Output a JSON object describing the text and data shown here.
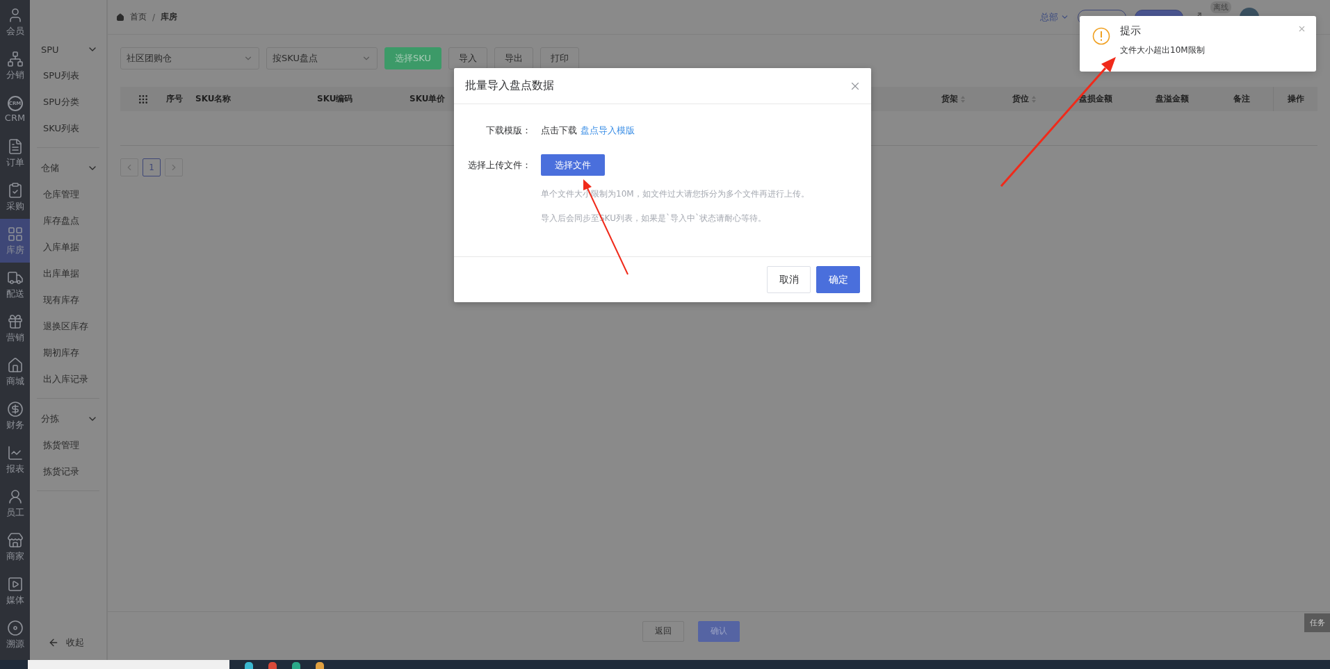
{
  "nav": [
    {
      "label": "会员",
      "selected": false
    },
    {
      "label": "分销",
      "selected": false
    },
    {
      "label": "CRM",
      "selected": false,
      "icon_text": "CRM"
    },
    {
      "label": "订单",
      "selected": false
    },
    {
      "label": "采购",
      "selected": false
    },
    {
      "label": "库房",
      "selected": true
    },
    {
      "label": "配送",
      "selected": false
    },
    {
      "label": "营销",
      "selected": false
    },
    {
      "label": "商城",
      "selected": false
    },
    {
      "label": "财务",
      "selected": false
    },
    {
      "label": "报表",
      "selected": false
    },
    {
      "label": "员工",
      "selected": false
    },
    {
      "label": "商家",
      "selected": false
    },
    {
      "label": "媒体",
      "selected": false
    },
    {
      "label": "溯源",
      "selected": false
    }
  ],
  "submenu": {
    "groups": [
      {
        "label": "SPU",
        "expanded": true,
        "items": [
          "SPU列表",
          "SPU分类",
          "SKU列表"
        ]
      },
      {
        "label": "仓储",
        "expanded": true,
        "items": [
          "仓库管理",
          "库存盘点",
          "入库单据",
          "出库单据",
          "现有库存",
          "退换区库存",
          "期初库存",
          "出入库记录"
        ]
      },
      {
        "label": "分拣",
        "expanded": true,
        "items": [
          "拣货管理",
          "拣货记录"
        ]
      }
    ],
    "collapse": "收起"
  },
  "breadcrumb": [
    "首页",
    "库房"
  ],
  "breadcrumb_separator": "/",
  "header": {
    "branch": "总部",
    "status_badge": "离线"
  },
  "toolbar": {
    "warehouse": "社区团购仓",
    "mode": "按SKU盘点",
    "buttons": [
      {
        "label": "选择SKU",
        "kind": "primary"
      },
      {
        "label": "导入",
        "kind": "plain"
      },
      {
        "label": "导出",
        "kind": "plain"
      },
      {
        "label": "打印",
        "kind": "plain"
      }
    ]
  },
  "table": {
    "columns_left": [
      {
        "label": "序号",
        "sortable": false
      },
      {
        "label": "SKU名称",
        "sortable": false
      },
      {
        "label": "SKU编码",
        "sortable": false
      },
      {
        "label": "SKU单价",
        "sortable": false
      }
    ],
    "columns_right": [
      {
        "label": "货架",
        "sortable": true
      },
      {
        "label": "货位",
        "sortable": true
      },
      {
        "label": "盘损金额",
        "sortable": false
      },
      {
        "label": "盘溢金额",
        "sortable": false
      },
      {
        "label": "备注",
        "sortable": false
      },
      {
        "label": "操作",
        "sortable": false
      }
    ]
  },
  "pagination": {
    "pages": [
      {
        "label": "1",
        "selected": true
      }
    ]
  },
  "footer": {
    "buttons": [
      {
        "label": "返回",
        "kind": "plain"
      },
      {
        "label": "确认",
        "kind": "primary"
      }
    ]
  },
  "side_tab": "任务",
  "dialog": {
    "title": "批量导入盘点数据",
    "template_label": "下载模版：",
    "template_text": "点击下载",
    "template_link": "盘点导入模版",
    "upload_label": "选择上传文件：",
    "upload_button": "选择文件",
    "hints": [
      "单个文件大小限制为10M，如文件过大请您拆分为多个文件再进行上传。",
      "导入后会同步至SKU列表，如果是`导入中`状态请耐心等待。"
    ],
    "buttons": [
      {
        "label": "取消",
        "kind": "plain"
      },
      {
        "label": "确定",
        "kind": "primary"
      }
    ]
  },
  "toast": {
    "title": "提示",
    "message": "文件大小超出10M限制"
  }
}
